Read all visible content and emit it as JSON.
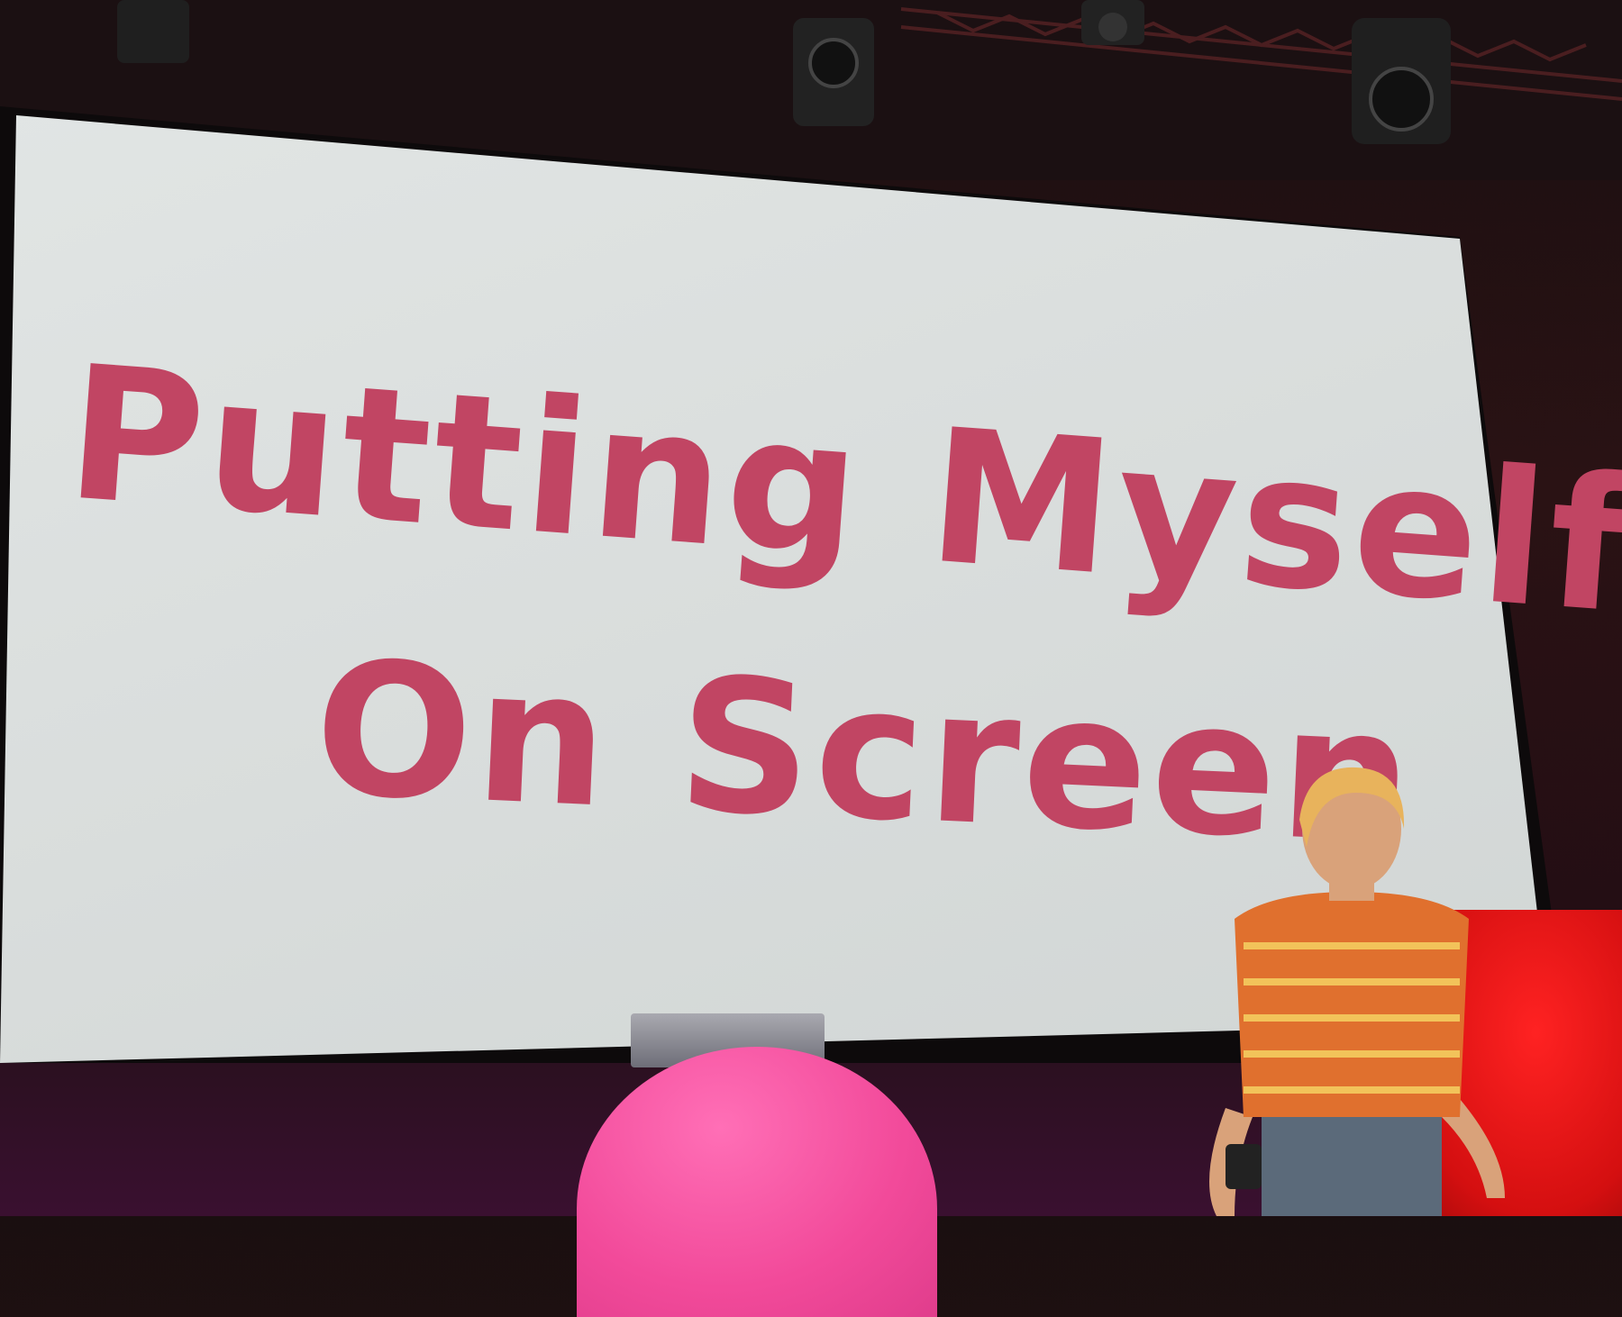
{
  "slide": {
    "title_line_1": "Putting Myself",
    "title_line_2": "On Screen"
  },
  "colors": {
    "slide_background": "#dde1e0",
    "title_text": "#c14563",
    "podium": "#f24a9a",
    "stage_backdrop_red": "#d40f10"
  }
}
